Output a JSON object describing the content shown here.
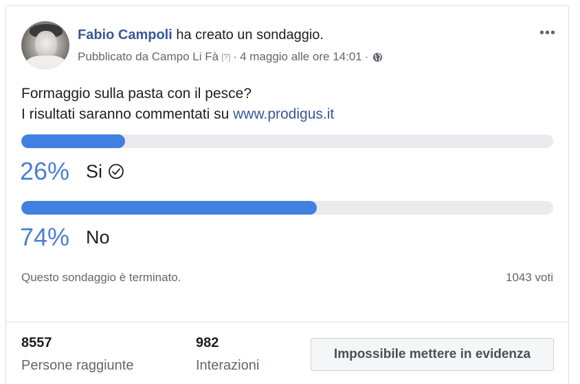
{
  "post": {
    "author": "Fabio Campoli",
    "action": "ha creato un sondaggio.",
    "published_by": "Pubblicato da Campo Li Fà",
    "help_mark": "[?]",
    "separator": "·",
    "timestamp": "4 maggio alle ore 14:01",
    "privacy_icon": "globe-icon",
    "more_icon": "•••",
    "line1": "Formaggio sulla pasta con il pesce?",
    "line2_prefix": "I risultati saranno commentati su ",
    "line2_link": "www.prodigus.it"
  },
  "poll": {
    "options": [
      {
        "percent_label": "26%",
        "percent": 26,
        "label": "Si",
        "winner_check": true
      },
      {
        "percent_label": "74%",
        "percent": 74,
        "label": "No",
        "winner_check": false
      }
    ],
    "status": "Questo sondaggio è terminato.",
    "votes": "1043 voti"
  },
  "stats": {
    "reach_value": "8557",
    "reach_label": "Persone raggiunte",
    "interactions_value": "982",
    "interactions_label": "Interazioni"
  },
  "boost_button": "Impossibile mettere in evidenza",
  "colors": {
    "bar_fill": "#4080e0",
    "bar_track": "#e9ebee",
    "link": "#385898",
    "percent": "#4a7fd6"
  }
}
